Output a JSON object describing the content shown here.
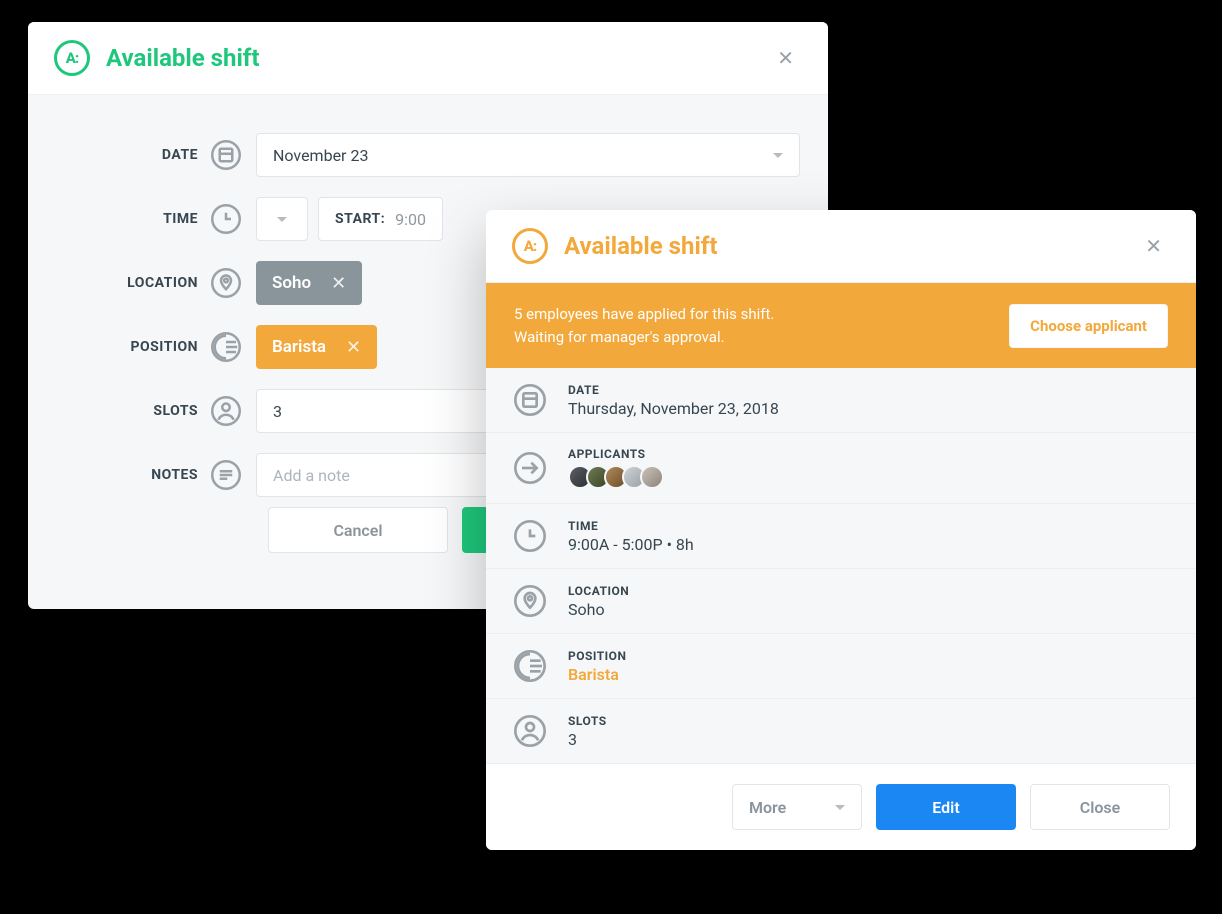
{
  "edit_modal": {
    "title": "Available shift",
    "labels": {
      "date": "DATE",
      "time": "TIME",
      "location": "LOCATION",
      "position": "POSITION",
      "slots": "SLOTS",
      "notes": "NOTES"
    },
    "date_value": "November 23",
    "start_label": "START:",
    "start_value": "9:00",
    "location_chip": "Soho",
    "position_chip": "Barista",
    "slots_value": "3",
    "notes_placeholder": "Add a note",
    "cancel": "Cancel"
  },
  "view_modal": {
    "title": "Available shift",
    "banner_line1": "5 employees have applied for this shift.",
    "banner_line2": "Waiting for manager's approval.",
    "choose_btn": "Choose applicant",
    "rows": {
      "date_label": "DATE",
      "date_value": "Thursday, November 23, 2018",
      "applicants_label": "APPLICANTS",
      "time_label": "TIME",
      "time_value": "9:00A - 5:00P • 8h",
      "location_label": "LOCATION",
      "location_value": "Soho",
      "position_label": "POSITION",
      "position_value": "Barista",
      "slots_label": "SLOTS",
      "slots_value": "3"
    },
    "footer": {
      "more": "More",
      "edit": "Edit",
      "close": "Close"
    }
  }
}
